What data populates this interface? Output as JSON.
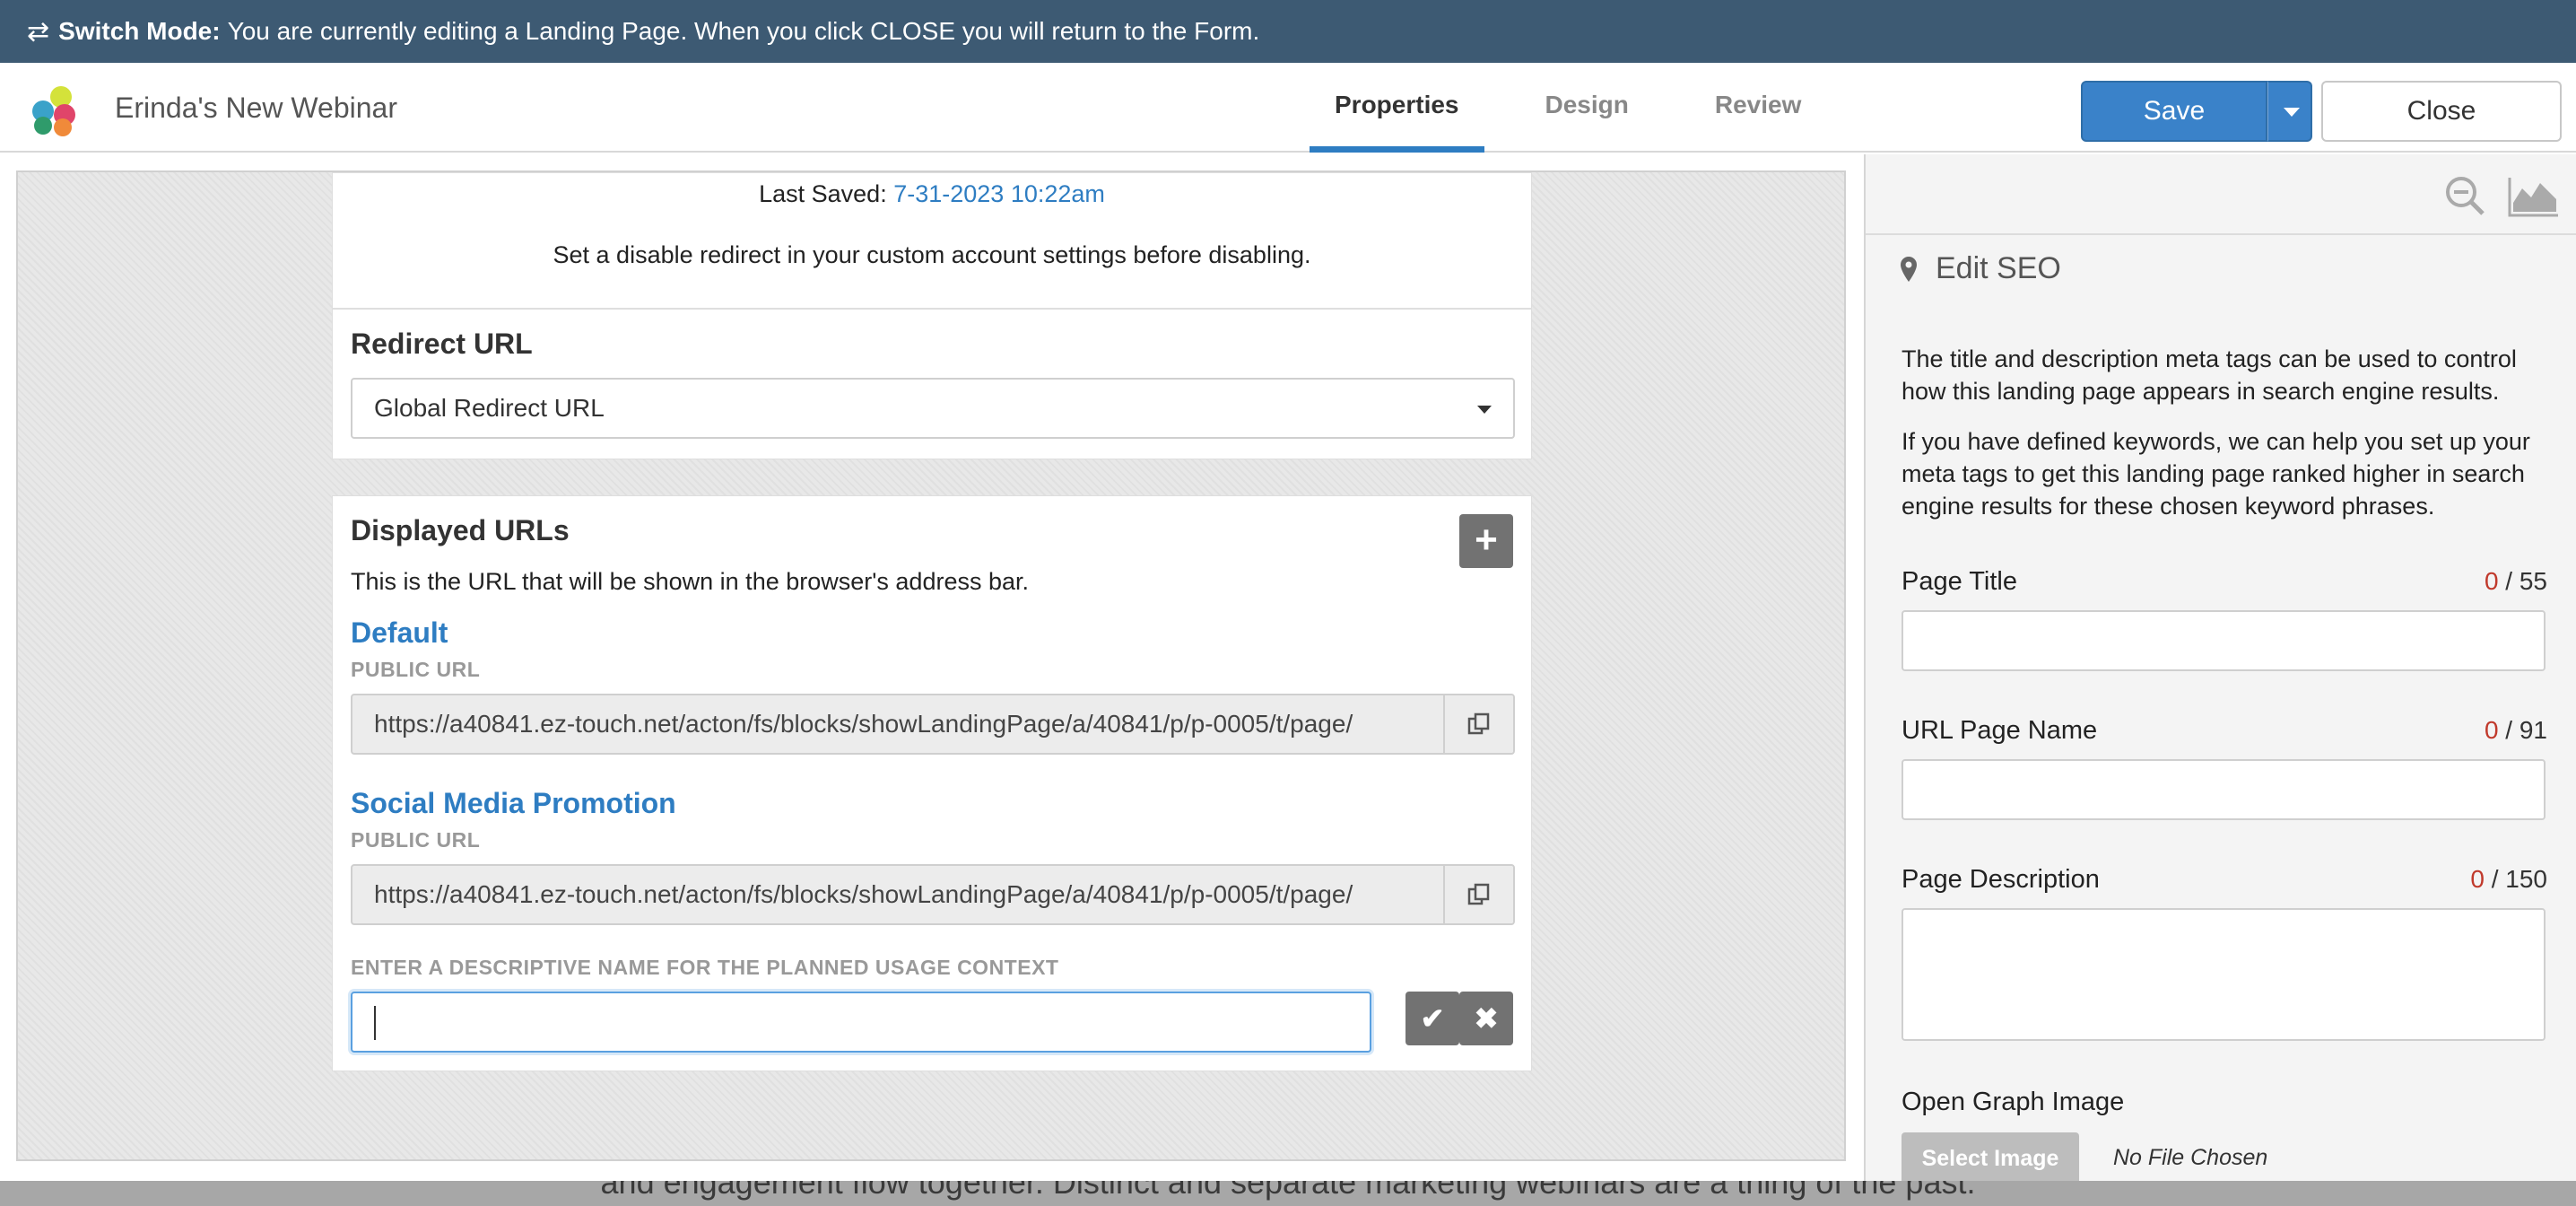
{
  "background_text": "and engagement flow together. Distinct and separate marketing webinars are a thing of the past.",
  "mode_banner": {
    "icon": "switch-arrows-icon",
    "label": "Switch Mode:",
    "message": "You are currently editing a Landing Page. When you click CLOSE you will return to the Form."
  },
  "header": {
    "title": "Erinda's New Webinar",
    "tabs": [
      {
        "label": "Properties",
        "active": true
      },
      {
        "label": "Design",
        "active": false
      },
      {
        "label": "Review",
        "active": false
      }
    ],
    "save_label": "Save",
    "close_label": "Close",
    "accent_color": "#3a82c9"
  },
  "status_card": {
    "last_saved_label": "Last Saved:",
    "last_saved_value": "7-31-2023 10:22am",
    "disable_note": "Set a disable redirect in your custom account settings before disabling."
  },
  "redirect": {
    "heading": "Redirect URL",
    "selected": "Global Redirect URL"
  },
  "displayed_urls": {
    "heading": "Displayed URLs",
    "description": "This is the URL that will be shown in the browser's address bar.",
    "items": [
      {
        "name": "Default",
        "url_label": "PUBLIC URL",
        "url": "https://a40841.ez-touch.net/acton/fs/blocks/showLandingPage/a/40841/p/p-0005/t/page/"
      },
      {
        "name": "Social Media Promotion",
        "url_label": "PUBLIC URL",
        "url": "https://a40841.ez-touch.net/acton/fs/blocks/showLandingPage/a/40841/p/p-0005/t/page/"
      }
    ],
    "context_label": "ENTER A DESCRIPTIVE NAME FOR THE PLANNED USAGE CONTEXT",
    "context_value": ""
  },
  "seo_panel": {
    "heading": "Edit SEO",
    "para1": "The title and description meta tags can be used to control how this landing page appears in search engine results.",
    "para2": "If you have defined keywords, we can help you set up your meta tags to get this landing page ranked higher in search engine results for these chosen keyword phrases.",
    "fields": [
      {
        "label": "Page Title",
        "count": "0",
        "max": "/ 55"
      },
      {
        "label": "URL Page Name",
        "count": "0",
        "max": "/ 91"
      },
      {
        "label": "Page Description",
        "count": "0",
        "max": "/ 150"
      }
    ],
    "og_label": "Open Graph Image",
    "select_image_label": "Select Image",
    "no_file_label": "No File Chosen"
  }
}
